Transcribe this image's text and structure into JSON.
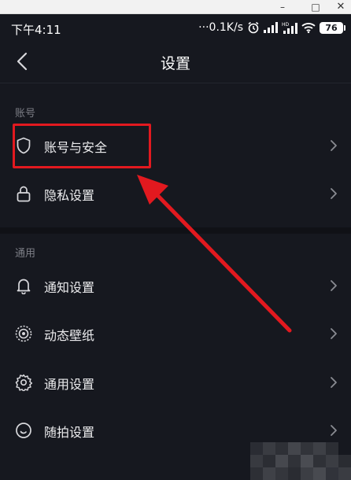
{
  "window": {
    "minimize_glyph": "–",
    "maximize_glyph": "□",
    "close_glyph": "✕"
  },
  "status_bar": {
    "time": "下午4:11",
    "network_speed": "0.1K/s",
    "battery_level": "76",
    "icons": [
      "alarm-icon",
      "signal-icon",
      "hd-signal-icon",
      "wifi-icon",
      "battery-icon"
    ]
  },
  "nav": {
    "title": "设置",
    "back_icon": "chevron-left-icon"
  },
  "sections": {
    "account": {
      "label": "账号",
      "items": [
        {
          "label": "账号与安全",
          "icon": "shield-icon"
        },
        {
          "label": "隐私设置",
          "icon": "lock-icon"
        }
      ]
    },
    "general": {
      "label": "通用",
      "items": [
        {
          "label": "通知设置",
          "icon": "bell-icon"
        },
        {
          "label": "动态壁纸",
          "icon": "live-wallpaper-icon"
        },
        {
          "label": "通用设置",
          "icon": "gear-icon"
        },
        {
          "label": "随拍设置",
          "icon": "snapshot-icon"
        }
      ]
    }
  },
  "annotation": {
    "highlight_color": "#e2191f",
    "highlighted_item": "账号与安全"
  },
  "colors": {
    "background": "#16181f",
    "text_primary": "#ececee",
    "text_secondary": "#7d7f87",
    "divider": "#101116"
  }
}
